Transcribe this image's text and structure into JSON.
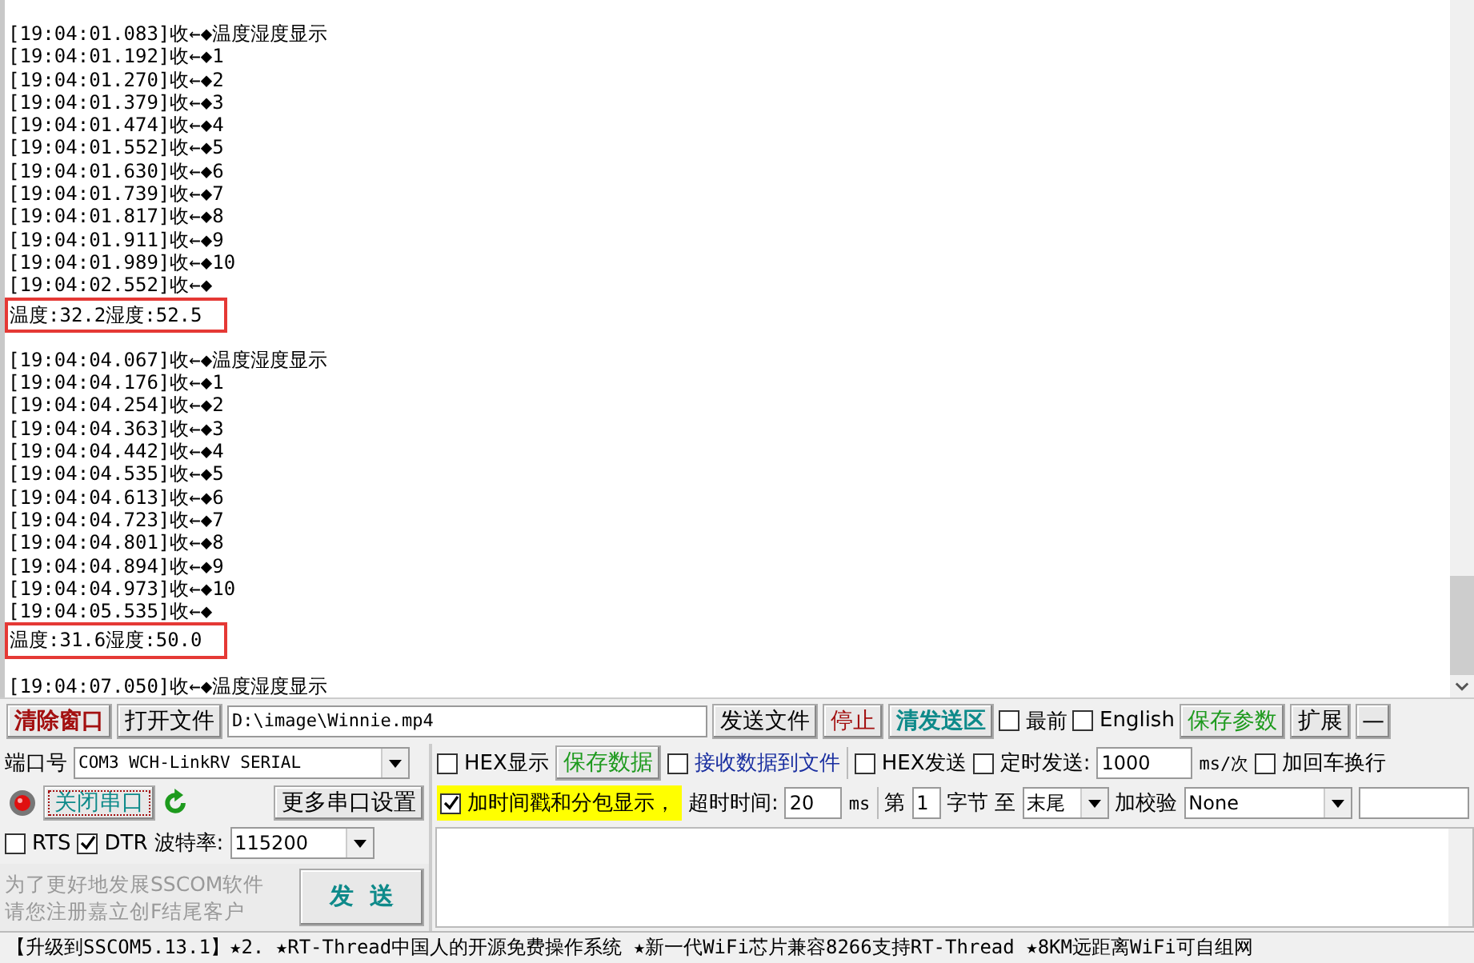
{
  "log": [
    {
      "kind": "line",
      "text": "[19:04:01.083]收←◆温度湿度显示"
    },
    {
      "kind": "line",
      "text": "[19:04:01.192]收←◆1"
    },
    {
      "kind": "line",
      "text": "[19:04:01.270]收←◆2"
    },
    {
      "kind": "line",
      "text": "[19:04:01.379]收←◆3"
    },
    {
      "kind": "line",
      "text": "[19:04:01.474]收←◆4"
    },
    {
      "kind": "line",
      "text": "[19:04:01.552]收←◆5"
    },
    {
      "kind": "line",
      "text": "[19:04:01.630]收←◆6"
    },
    {
      "kind": "line",
      "text": "[19:04:01.739]收←◆7"
    },
    {
      "kind": "line",
      "text": "[19:04:01.817]收←◆8"
    },
    {
      "kind": "line",
      "text": "[19:04:01.911]收←◆9"
    },
    {
      "kind": "line",
      "text": "[19:04:01.989]收←◆10"
    },
    {
      "kind": "line",
      "text": "[19:04:02.552]收←◆"
    },
    {
      "kind": "result",
      "text": "温度:32.2湿度:52.5"
    },
    {
      "kind": "line",
      "text": "[19:04:04.067]收←◆温度湿度显示"
    },
    {
      "kind": "line",
      "text": "[19:04:04.176]收←◆1"
    },
    {
      "kind": "line",
      "text": "[19:04:04.254]收←◆2"
    },
    {
      "kind": "line",
      "text": "[19:04:04.363]收←◆3"
    },
    {
      "kind": "line",
      "text": "[19:04:04.442]收←◆4"
    },
    {
      "kind": "line",
      "text": "[19:04:04.535]收←◆5"
    },
    {
      "kind": "line",
      "text": "[19:04:04.613]收←◆6"
    },
    {
      "kind": "line",
      "text": "[19:04:04.723]收←◆7"
    },
    {
      "kind": "line",
      "text": "[19:04:04.801]收←◆8"
    },
    {
      "kind": "line",
      "text": "[19:04:04.894]收←◆9"
    },
    {
      "kind": "line",
      "text": "[19:04:04.973]收←◆10"
    },
    {
      "kind": "line",
      "text": "[19:04:05.535]收←◆"
    },
    {
      "kind": "result",
      "text": "温度:31.6湿度:50.0"
    },
    {
      "kind": "line",
      "text": "[19:04:07.050]收←◆温度湿度显示"
    }
  ],
  "toolbar": {
    "clear_button": "清除窗口",
    "open_file_button": "打开文件",
    "file_path": "D:\\image\\Winnie.mp4",
    "send_file_button": "发送文件",
    "stop_button": "停止",
    "clear_send_button": "清发送区",
    "topmost": {
      "label": "最前",
      "checked": false
    },
    "english": {
      "label": "English",
      "checked": false
    },
    "save_params_button": "保存参数",
    "expand_button": "扩展",
    "minimize_button": "—"
  },
  "port": {
    "label": "端口号",
    "value": "COM3 WCH-LinkRV SERIAL"
  },
  "close_port_button": "关闭串口",
  "more_settings_button": "更多串口设置",
  "rts": {
    "label": "RTS",
    "checked": false
  },
  "dtr": {
    "label": "DTR",
    "checked": true
  },
  "baud": {
    "label": "波特率:",
    "value": "115200"
  },
  "promo": [
    "为了更好地发展SSCOM软件",
    "请您注册嘉立创F结尾客户"
  ],
  "send_button": "发  送",
  "hex_display": {
    "label": "HEX显示",
    "checked": false
  },
  "save_data_button": "保存数据",
  "receive_to_file": {
    "label": "接收数据到文件",
    "checked": false
  },
  "hex_send": {
    "label": "HEX发送",
    "checked": false
  },
  "timed_send": {
    "label": "定时发送:",
    "checked": false,
    "value": "1000",
    "unit": "ms/次"
  },
  "add_crlf": {
    "label": "加回车换行",
    "checked": false
  },
  "timestamp": {
    "label": "加时间戳和分包显示，",
    "checked": true
  },
  "timeout": {
    "label": "超时时间:",
    "value": "20",
    "unit": "ms"
  },
  "byte_from": {
    "label": "第",
    "value": "1",
    "unit": "字节"
  },
  "byte_to": {
    "label": "至",
    "value": "末尾"
  },
  "checksum": {
    "label": "加校验",
    "value": "None"
  },
  "status_bar": "【升级到SSCOM5.13.1】★2. ★RT-Thread中国人的开源免费操作系统 ★新一代WiFi芯片兼容8266支持RT-Thread ★8KM远距离WiFi可自组网"
}
